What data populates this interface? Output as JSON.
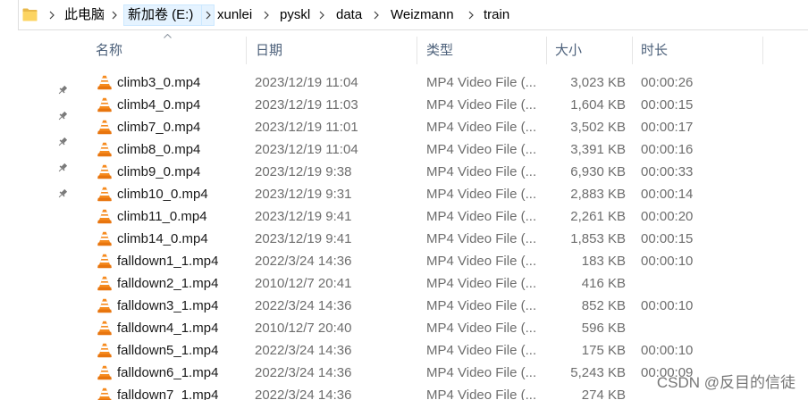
{
  "address_bar": {
    "location_icon": "folder-icon",
    "separator_icon": "chevron-right-icon",
    "breadcrumb": [
      {
        "label": "此电脑"
      },
      {
        "label": "新加卷 (E:)",
        "hovered": true
      },
      {
        "label": "xunlei"
      },
      {
        "label": "pyskl"
      },
      {
        "label": "data"
      },
      {
        "label": "Weizmann"
      },
      {
        "label": "train"
      }
    ]
  },
  "nav_pane": {
    "pinned_items": [
      {
        "icon": "pin-icon"
      },
      {
        "icon": "pin-icon"
      },
      {
        "icon": "pin-icon"
      },
      {
        "icon": "pin-icon"
      },
      {
        "icon": "pin-icon"
      }
    ]
  },
  "columns": {
    "name": {
      "label": "名称",
      "sort_icon": "sort-ascending-icon"
    },
    "date": {
      "label": "日期"
    },
    "type": {
      "label": "类型"
    },
    "size": {
      "label": "大小"
    },
    "duration": {
      "label": "时长"
    }
  },
  "file_icon": "vlc-icon",
  "files": [
    {
      "name": "climb3_0.mp4",
      "date": "2023/12/19 11:04",
      "type": "MP4 Video File (...",
      "size": "3,023 KB",
      "duration": "00:00:26"
    },
    {
      "name": "climb4_0.mp4",
      "date": "2023/12/19 11:03",
      "type": "MP4 Video File (...",
      "size": "1,604 KB",
      "duration": "00:00:15"
    },
    {
      "name": "climb7_0.mp4",
      "date": "2023/12/19 11:01",
      "type": "MP4 Video File (...",
      "size": "3,502 KB",
      "duration": "00:00:17"
    },
    {
      "name": "climb8_0.mp4",
      "date": "2023/12/19 11:04",
      "type": "MP4 Video File (...",
      "size": "3,391 KB",
      "duration": "00:00:16"
    },
    {
      "name": "climb9_0.mp4",
      "date": "2023/12/19 9:38",
      "type": "MP4 Video File (...",
      "size": "6,930 KB",
      "duration": "00:00:33"
    },
    {
      "name": "climb10_0.mp4",
      "date": "2023/12/19 9:31",
      "type": "MP4 Video File (...",
      "size": "2,883 KB",
      "duration": "00:00:14"
    },
    {
      "name": "climb11_0.mp4",
      "date": "2023/12/19 9:41",
      "type": "MP4 Video File (...",
      "size": "2,261 KB",
      "duration": "00:00:20"
    },
    {
      "name": "climb14_0.mp4",
      "date": "2023/12/19 9:41",
      "type": "MP4 Video File (...",
      "size": "1,853 KB",
      "duration": "00:00:15"
    },
    {
      "name": "falldown1_1.mp4",
      "date": "2022/3/24 14:36",
      "type": "MP4 Video File (...",
      "size": "183 KB",
      "duration": "00:00:10"
    },
    {
      "name": "falldown2_1.mp4",
      "date": "2010/12/7 20:41",
      "type": "MP4 Video File (...",
      "size": "416 KB",
      "duration": ""
    },
    {
      "name": "falldown3_1.mp4",
      "date": "2022/3/24 14:36",
      "type": "MP4 Video File (...",
      "size": "852 KB",
      "duration": "00:00:10"
    },
    {
      "name": "falldown4_1.mp4",
      "date": "2010/12/7 20:40",
      "type": "MP4 Video File (...",
      "size": "596 KB",
      "duration": ""
    },
    {
      "name": "falldown5_1.mp4",
      "date": "2022/3/24 14:36",
      "type": "MP4 Video File (...",
      "size": "175 KB",
      "duration": "00:00:10"
    },
    {
      "name": "falldown6_1.mp4",
      "date": "2022/3/24 14:36",
      "type": "MP4 Video File (...",
      "size": "5,243 KB",
      "duration": "00:00:09"
    },
    {
      "name": "falldown7_1.mp4",
      "date": "2022/3/24 14:36",
      "type": "MP4 Video File (...",
      "size": "274 KB",
      "duration": ""
    }
  ],
  "watermark": "CSDN @反目的信徒",
  "colors": {
    "hover_bg": "#e5f3ff",
    "hover_border": "#cce8ff",
    "header_text": "#4c607a",
    "secondary_text": "#6d6d6d",
    "vlc_orange": "#f68b1f"
  }
}
